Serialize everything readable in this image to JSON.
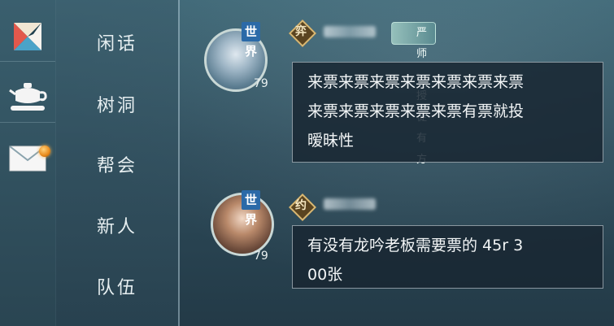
{
  "sidebar_icons": [
    {
      "icon": "compass-star-icon",
      "badge": false
    },
    {
      "icon": "teapot-icon",
      "badge": false
    },
    {
      "icon": "mail-icon",
      "badge": true
    }
  ],
  "channels": [
    "闲话",
    "树洞",
    "帮会",
    "新人",
    "队伍"
  ],
  "messages": [
    {
      "channel_tag": "世界",
      "faction_tag": "弈",
      "title_badge": "严师 · 授徒有方",
      "level": "79",
      "text": "来票来票来票来票来票来票来票\n来票来票来票来票来票有票就投\n暧昧性"
    },
    {
      "channel_tag": "世界",
      "faction_tag": "约",
      "title_badge": "",
      "level": "79",
      "text": "有没有龙吟老板需要票的 45r 3\n00张"
    }
  ],
  "colors": {
    "world_tag": "#2b6aa8",
    "faction_diamond": "#5a4420",
    "notify_badge": "#e88a1c"
  }
}
